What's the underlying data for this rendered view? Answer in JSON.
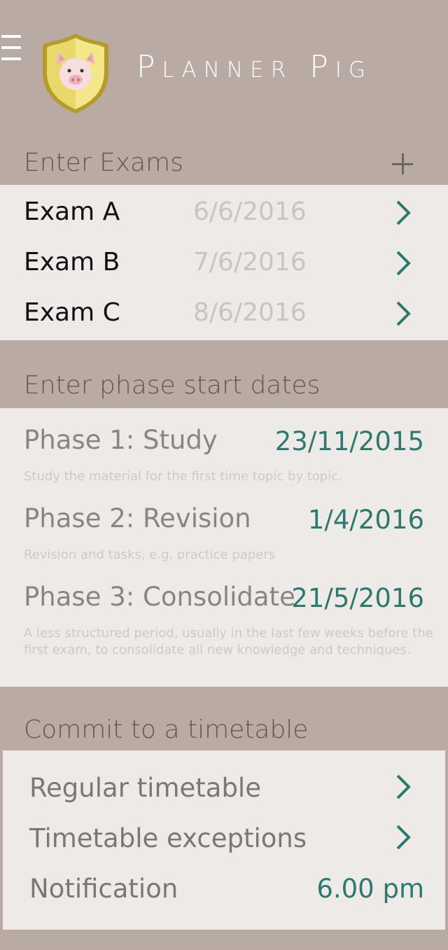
{
  "header": {
    "title": "Planner Pig",
    "menu_icon": "hamburger-icon",
    "logo_icon": "pig-shield-icon"
  },
  "exams": {
    "title": "Enter Exams",
    "add_icon": "plus-icon",
    "items": [
      {
        "name": "Exam A",
        "date": "6/6/2016"
      },
      {
        "name": "Exam B",
        "date": "7/6/2016"
      },
      {
        "name": "Exam C",
        "date": "8/6/2016"
      }
    ]
  },
  "phases": {
    "title": "Enter phase start dates",
    "items": [
      {
        "name": "Phase 1: Study",
        "date": "23/11/2015",
        "desc": "Study the material for the first time topic by topic."
      },
      {
        "name": "Phase 2: Revision",
        "date": "1/4/2016",
        "desc": "Revision and tasks, e.g. practice papers"
      },
      {
        "name": "Phase 3: Consolidate",
        "date": "21/5/2016",
        "desc": "A less structured period, usually in the last few weeks before the first exam, to consolidate all new knowledge and techniques."
      }
    ]
  },
  "timetable": {
    "title": "Commit to a timetable",
    "regular_label": "Regular timetable",
    "exceptions_label": "Timetable exceptions",
    "notification_label": "Notification",
    "notification_value": "6.00 pm"
  },
  "colors": {
    "background": "#b9aaa3",
    "panel": "#eeeae8",
    "accent": "#2a7a6e",
    "section_title": "#6b544c"
  }
}
